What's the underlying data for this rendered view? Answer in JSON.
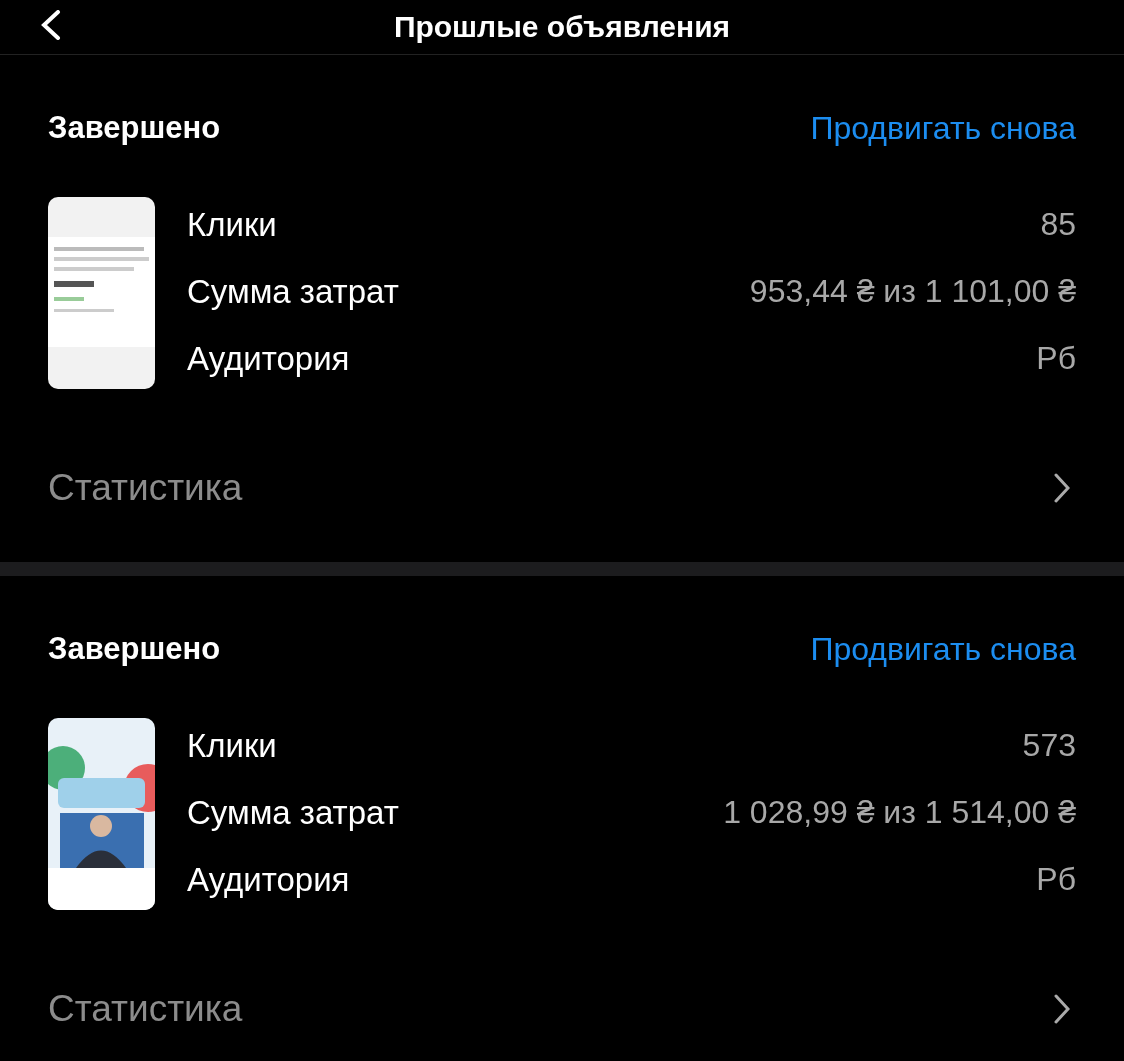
{
  "header": {
    "title": "Прошлые объявления"
  },
  "ads": [
    {
      "status": "Завершено",
      "action": "Продвигать снова",
      "metrics": [
        {
          "label": "Клики",
          "value": "85"
        },
        {
          "label": "Сумма затрат",
          "value": "953,44 ₴ из 1 101,00 ₴"
        },
        {
          "label": "Аудитория",
          "value": "Рб"
        }
      ],
      "stats_link": "Статистика"
    },
    {
      "status": "Завершено",
      "action": "Продвигать снова",
      "metrics": [
        {
          "label": "Клики",
          "value": "573"
        },
        {
          "label": "Сумма затрат",
          "value": "1 028,99 ₴ из 1 514,00 ₴"
        },
        {
          "label": "Аудитория",
          "value": "Рб"
        }
      ],
      "stats_link": "Статистика"
    }
  ]
}
